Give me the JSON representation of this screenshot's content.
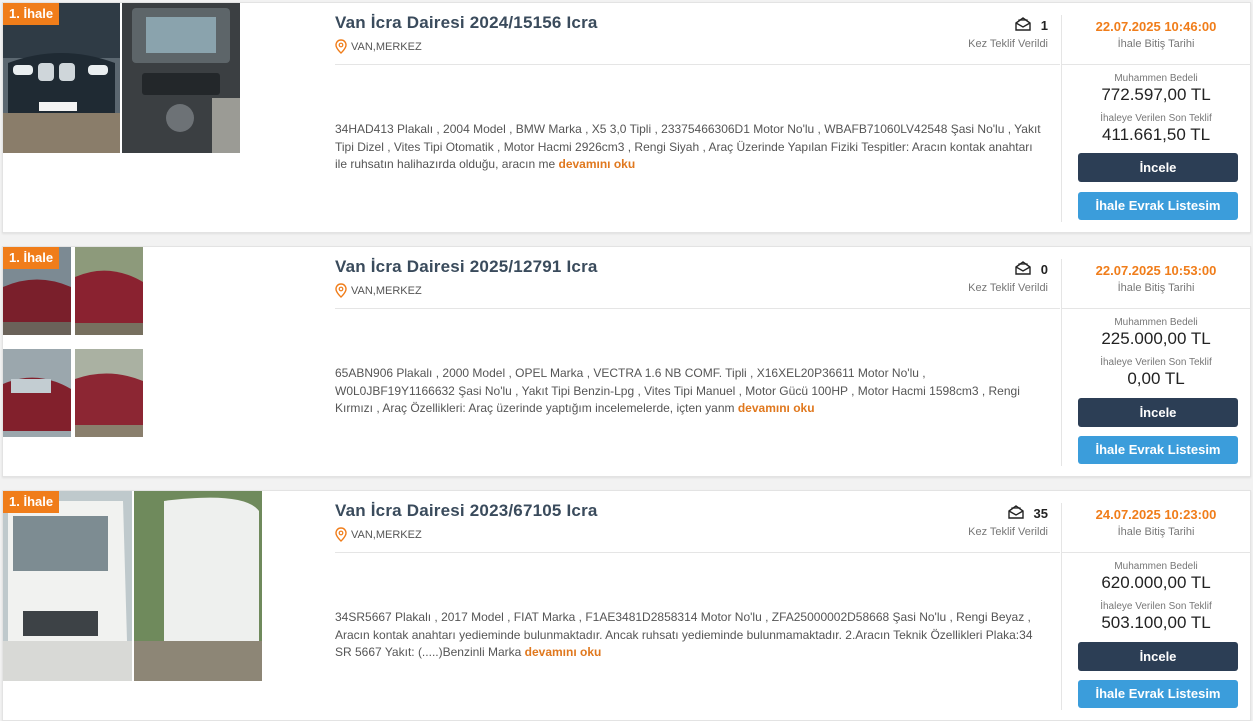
{
  "listings": [
    {
      "badge": "1. İhale",
      "title": "Van İcra Dairesi 2024/15156 Icra",
      "location": "VAN,MERKEZ",
      "offer_count": "1",
      "offer_label": "Kez Teklif Verildi",
      "description": "34HAD413 Plakalı , 2004 Model , BMW Marka , X5 3,0 Tipli , 23375466306D1 Motor No'lu , WBAFB71060LV42548 Şasi No'lu , Yakıt Tipi Dizel , Vites Tipi Otomatik , Motor Hacmi 2926cm3 , Rengi Siyah , Araç Üzerinde Yapılan Fiziki Tespitler: Aracın kontak anahtarı ile ruhsatın halihazırda olduğu, aracın me",
      "more_label": "devamını oku",
      "end_date": "22.07.2025 10:46:00",
      "end_date_label": "İhale Bitiş Tarihi",
      "estimated_label": "Muhammen Bedeli",
      "estimated_value": "772.597,00 TL",
      "last_offer_label": "İhaleye Verilen Son Teklif",
      "last_offer_value": "411.661,50 TL",
      "inspect_label": "İncele",
      "docs_label": "İhale Evrak Listesim"
    },
    {
      "badge": "1. İhale",
      "title": "Van İcra Dairesi 2025/12791 Icra",
      "location": "VAN,MERKEZ",
      "offer_count": "0",
      "offer_label": "Kez Teklif Verildi",
      "description": "65ABN906 Plakalı , 2000 Model , OPEL Marka , VECTRA 1.6 NB COMF. Tipli , X16XEL20P36611 Motor No'lu , W0L0JBF19Y1166632 Şasi No'lu , Yakıt Tipi Benzin-Lpg , Vites Tipi Manuel , Motor Gücü 100HP , Motor Hacmi 1598cm3 , Rengi Kırmızı , Araç Özellikleri: Araç üzerinde yaptığım incelemelerde, içten yanm",
      "more_label": "devamını oku",
      "end_date": "22.07.2025 10:53:00",
      "end_date_label": "İhale Bitiş Tarihi",
      "estimated_label": "Muhammen Bedeli",
      "estimated_value": "225.000,00 TL",
      "last_offer_label": "İhaleye Verilen Son Teklif",
      "last_offer_value": "0,00 TL",
      "inspect_label": "İncele",
      "docs_label": "İhale Evrak Listesim"
    },
    {
      "badge": "1. İhale",
      "title": "Van İcra Dairesi 2023/67105 Icra",
      "location": "VAN,MERKEZ",
      "offer_count": "35",
      "offer_label": "Kez Teklif Verildi",
      "description": "34SR5667 Plakalı , 2017 Model , FIAT Marka , F1AE3481D2858314 Motor No'lu , ZFA25000002D58668 Şasi No'lu , Rengi Beyaz , Aracın kontak anahtarı yedieminde bulunmaktadır. Ancak ruhsatı yedieminde bulunmamaktadır. 2.Aracın Teknik Özellikleri Plaka:34 SR 5667 Yakıt: (.....)Benzinli Marka",
      "more_label": "devamını oku",
      "end_date": "24.07.2025 10:23:00",
      "end_date_label": "İhale Bitiş Tarihi",
      "estimated_label": "Muhammen Bedeli",
      "estimated_value": "620.000,00 TL",
      "last_offer_label": "İhaleye Verilen Son Teklif",
      "last_offer_value": "503.100,00 TL",
      "inspect_label": "İncele",
      "docs_label": "İhale Evrak Listesim"
    }
  ],
  "colors": {
    "accent_orange": "#f07d1a",
    "title_slate": "#3a4b5c",
    "button_dark": "#2c3e55",
    "button_blue": "#3b9ddb"
  },
  "icons": {
    "location": "map-pin-icon",
    "offers": "envelope-open-icon"
  }
}
